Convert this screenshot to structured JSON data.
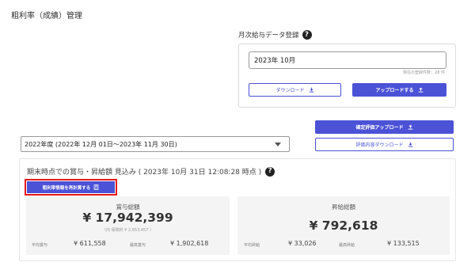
{
  "page": {
    "title": "粗利率（成績）管理"
  },
  "monthly_upload": {
    "label": "月次給与データ登録",
    "month_value": "2023年 10月",
    "registered_count": "現在の登録件数：28 件",
    "download_label": "ダウンロード",
    "upload_label": "アップロードする"
  },
  "fiscal": {
    "confirmed_upload_label": "確定評価アップロード",
    "evaluation_download_label": "評価内容ダウンロード",
    "year_select": "2022年度 (2022年 12月 01日〜2023年 11月 30日)"
  },
  "summary": {
    "title": "期末時点での賞与・昇給額 見込み ( 2023年 10月 31日 12:08:28 時点 )",
    "recalc_label": "粗利率情報を再計算する",
    "bonus": {
      "title": "賞与総額",
      "total": "¥ 17,942,399",
      "note": "（内 保険料 ¥ 2,653,457 ）",
      "avg_label": "平均賞与",
      "avg_value": "¥ 611,558",
      "max_label": "最高賞与",
      "max_value": "¥ 1,902,618"
    },
    "raise": {
      "title": "昇給総額",
      "total": "¥ 792,618",
      "avg_label": "平均昇給",
      "avg_value": "¥ 33,026",
      "max_label": "最高昇給",
      "max_value": "¥ 133,515"
    }
  },
  "colors": {
    "primary": "#4b52d6",
    "highlight": "#e61919"
  }
}
